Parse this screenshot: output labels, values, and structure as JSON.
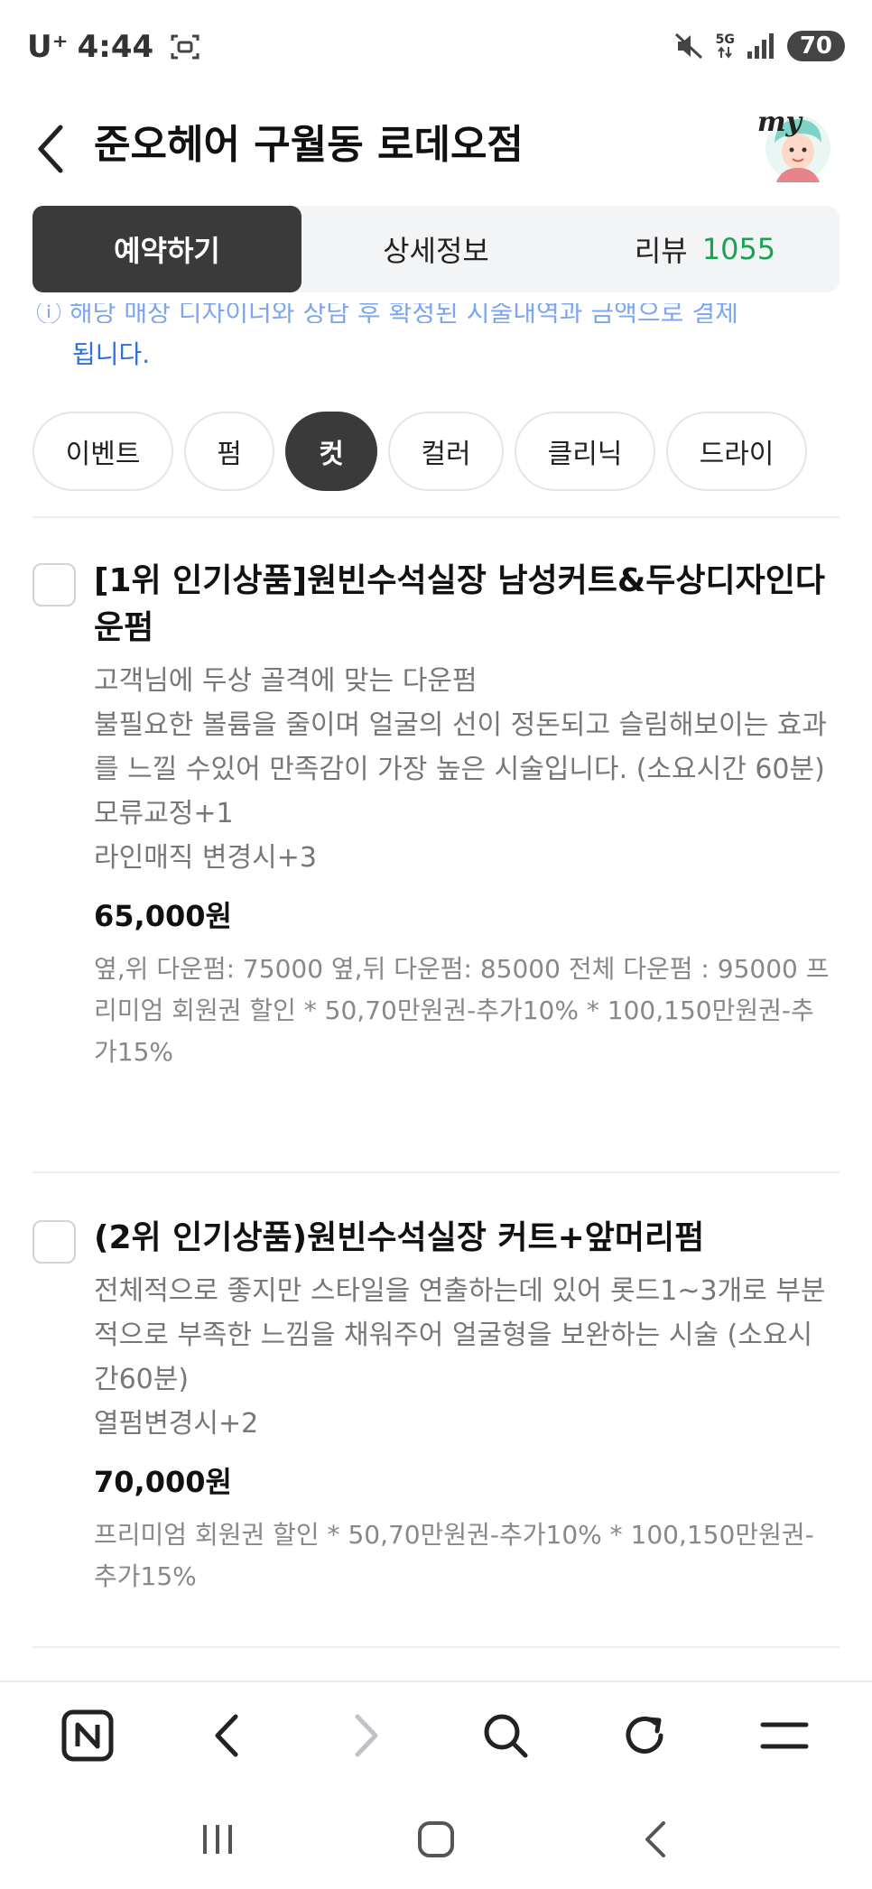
{
  "status_bar": {
    "carrier": "U⁺",
    "time": "4:44",
    "network": "5G",
    "battery": "70"
  },
  "header": {
    "title": "준오헤어 구월동 로데오점",
    "my_label": "my"
  },
  "tabs": [
    {
      "label": "예약하기",
      "active": true
    },
    {
      "label": "상세정보",
      "active": false
    },
    {
      "label": "리뷰",
      "count": "1055",
      "active": false
    }
  ],
  "notice": {
    "partial_line": "ⓘ 해당 매장 디자이너와 상담 후 확정된 시술내역과 금액으로 결제",
    "second_line": "됩니다."
  },
  "chips": [
    {
      "label": "이벤트",
      "active": false
    },
    {
      "label": "펌",
      "active": false
    },
    {
      "label": "컷",
      "active": true
    },
    {
      "label": "컬러",
      "active": false
    },
    {
      "label": "클리닉",
      "active": false
    },
    {
      "label": "드라이",
      "active": false
    }
  ],
  "items": [
    {
      "title": "[1위 인기상품]원빈수석실장 남성커트&두상디자인다운펌",
      "description": [
        "고객님에 두상 골격에 맞는 다운펌",
        "불필요한 볼륨을 줄이며 얼굴의 선이 정돈되고 슬림해보이는 효과를 느낄 수있어 만족감이 가장 높은 시술입니다. (소요시간 60분)",
        "모류교정+1",
        "라인매직 변경시+3"
      ],
      "price": "65,000원",
      "note": "옆,위 다운펌: 75000 옆,뒤 다운펌: 85000 전체 다운펌 : 95000 프리미엄 회원권 할인 * 50,70만원권-추가10% * 100,150만원권-추가15%"
    },
    {
      "title": "(2위 인기상품)원빈수석실장 커트+앞머리펌",
      "description": [
        "전체적으로 좋지만 스타일을 연출하는데 있어 롯드1~3개로 부분적으로 부족한 느낌을 채워주어 얼굴형을 보완하는 시술 (소요시간60분)",
        "열펌변경시+2"
      ],
      "price": "70,000원",
      "note": "프리미엄 회원권 할인 * 50,70만원권-추가10% * 100,150만원권-추가15%"
    }
  ],
  "browser_toolbar": {
    "icons": [
      "naver-home-icon",
      "back-icon",
      "forward-icon",
      "search-icon",
      "refresh-icon",
      "menu-icon"
    ]
  },
  "system_nav": {
    "icons": [
      "recent-apps-icon",
      "home-icon",
      "system-back-icon"
    ]
  }
}
